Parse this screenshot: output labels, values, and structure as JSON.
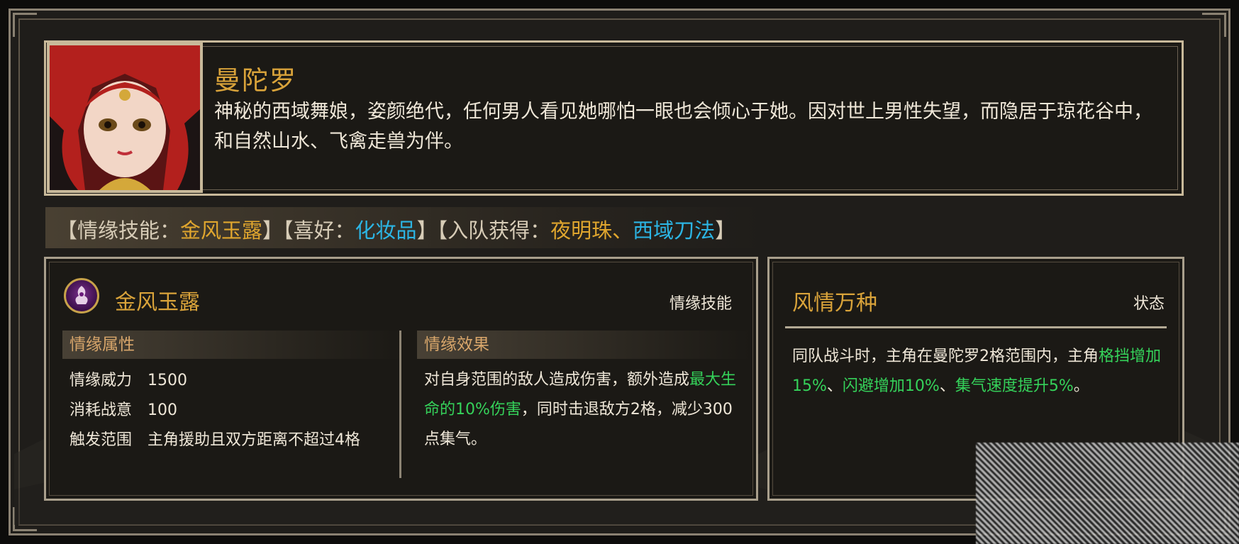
{
  "character": {
    "name": "曼陀罗",
    "description": "神秘的西域舞娘，姿颜绝代，任何男人看见她哪怕一眼也会倾心于她。因对世上男性失望，而隐居于琼花谷中，和自然山水、飞禽走兽为伴。"
  },
  "info": {
    "p1": "【情缘技能：",
    "skill": "金风玉露",
    "p2": "】【喜好：",
    "hobby": "化妆品",
    "p3": "】【入队获得：",
    "item1": "夜明珠",
    "sep": "、",
    "item2": "西域刀法",
    "p4": "】"
  },
  "skill_panel": {
    "title": "金风玉露",
    "tag": "情缘技能",
    "attr_header": "情缘属性",
    "effect_header": "情缘效果",
    "attrs": [
      {
        "key": "情缘威力",
        "value": "1500"
      },
      {
        "key": "消耗战意",
        "value": "100"
      },
      {
        "key": "触发范围",
        "value": "主角援助且双方距离不超过4格"
      }
    ],
    "effect": {
      "a": "对自身范围的敌人造成伤害，额外造成",
      "b": "最大生命的10%伤害",
      "c": "，同时击退敌方2格，减少300点集气。"
    }
  },
  "state_panel": {
    "title": "风情万种",
    "tag": "状态",
    "desc": {
      "a": "同队战斗时，主角在曼陀罗2格范围内，主角",
      "b": "格挡增加15%",
      "c": "、",
      "d": "闪避增加10%",
      "e": "、",
      "f": "集气速度提升5%",
      "g": "。"
    }
  },
  "colors": {
    "gold": "#d9a33a",
    "blue": "#2cb5e4",
    "green": "#35d25a"
  }
}
